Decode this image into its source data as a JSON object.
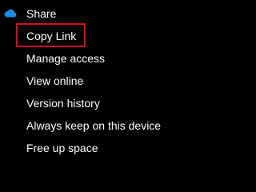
{
  "menu": {
    "items": [
      {
        "label": "Share",
        "icon": "onedrive-cloud-icon"
      },
      {
        "label": "Copy Link"
      },
      {
        "label": "Manage access"
      },
      {
        "label": "View online"
      },
      {
        "label": "Version history"
      },
      {
        "label": "Always keep on this device"
      },
      {
        "label": "Free up space"
      }
    ],
    "highlight_color": "#d1131a",
    "icon_color": "#1f8ce6"
  }
}
